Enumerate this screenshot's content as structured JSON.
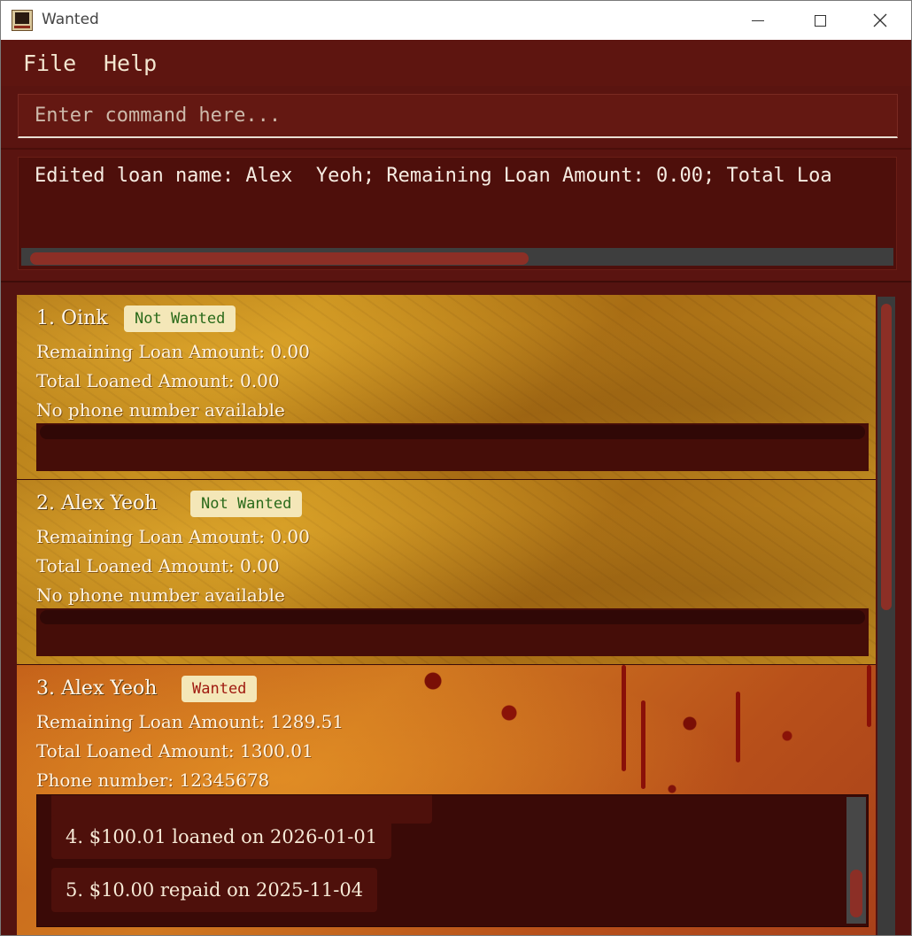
{
  "window": {
    "title": "Wanted",
    "icon": "wanted-list-app-icon"
  },
  "menu": {
    "file": "File",
    "help": "Help"
  },
  "command": {
    "placeholder": "Enter command here...",
    "value": ""
  },
  "result": {
    "text": "Edited loan name: Alex  Yeoh; Remaining Loan Amount: 0.00; Total Loa"
  },
  "people": [
    {
      "index": "1.",
      "name": "Oink",
      "badge": "Not Wanted",
      "remaining": "Remaining Loan Amount: 0.00",
      "total": "Total Loaned Amount: 0.00",
      "phone": "No phone number available",
      "loans": []
    },
    {
      "index": "2.",
      "name": "Alex Yeoh",
      "badge": "Not Wanted",
      "remaining": "Remaining Loan Amount: 0.00",
      "total": "Total Loaned Amount: 0.00",
      "phone": "No phone number available",
      "loans": []
    },
    {
      "index": "3.",
      "name": "Alex Yeoh",
      "badge": "Wanted",
      "remaining": "Remaining Loan Amount: 1289.51",
      "total": "Total Loaned Amount: 1300.01",
      "phone": "Phone number: 12345678",
      "loans": [
        "4. $100.01 loaned on 2026-01-01",
        "5. $10.00 repaid on 2025-11-04"
      ]
    }
  ],
  "colors": {
    "background": "#5a1410",
    "badge_bg": "#f4e7b8",
    "not_wanted_text": "#2a6a1a",
    "wanted_text": "#a01a10",
    "scroll_thumb": "#8c2f26"
  }
}
